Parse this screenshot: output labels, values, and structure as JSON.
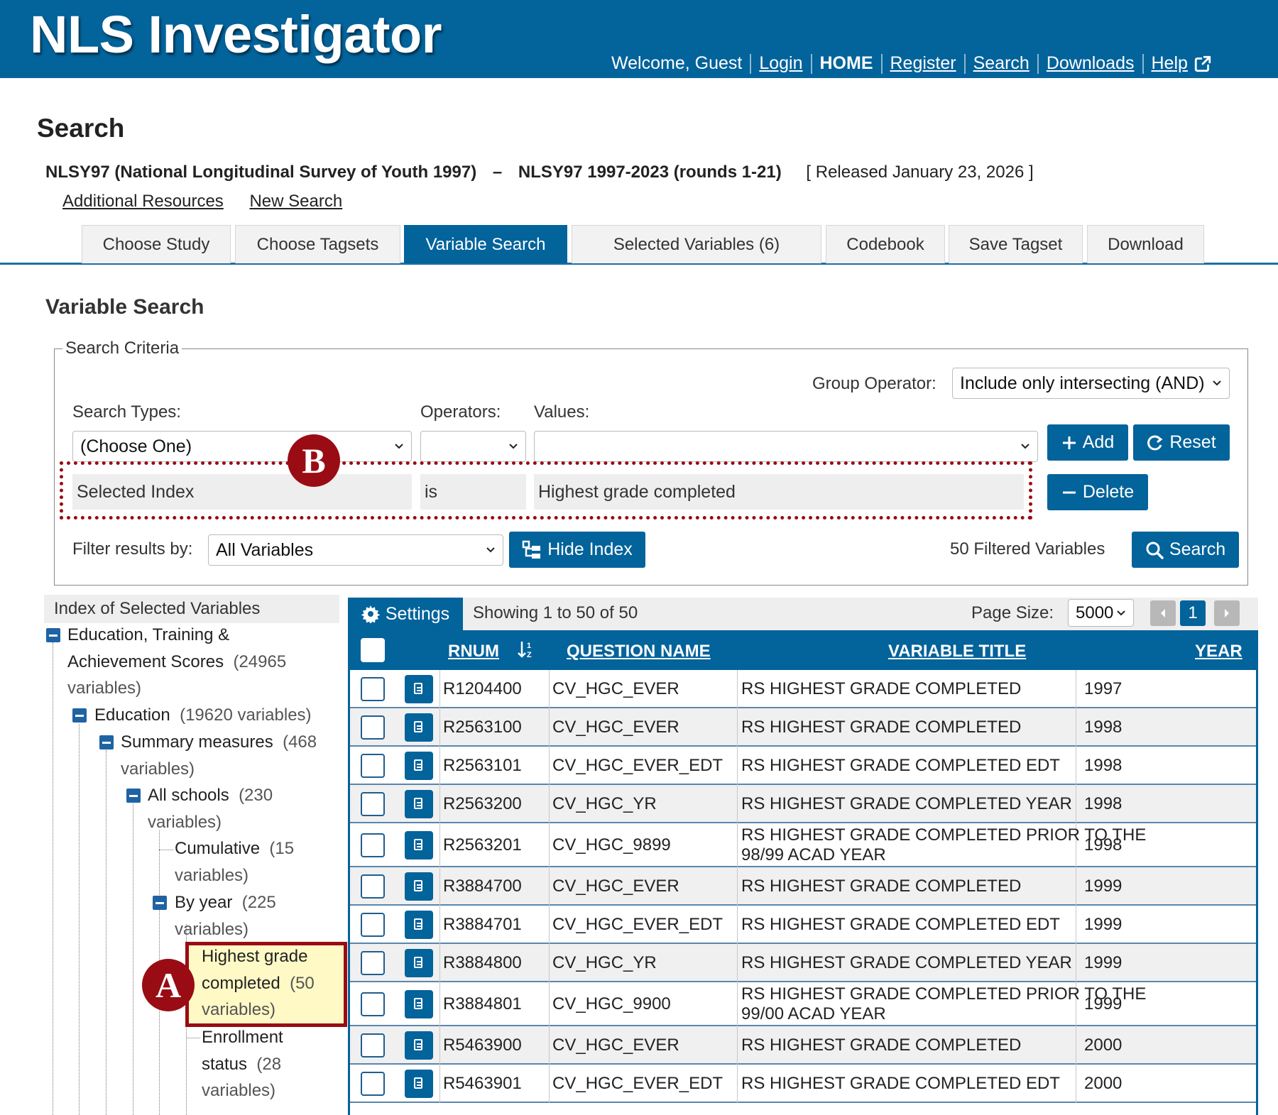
{
  "header": {
    "app_title": "NLS Investigator",
    "welcome": "Welcome, Guest",
    "links": [
      "Login",
      "HOME",
      "Register",
      "Search",
      "Downloads",
      "Help"
    ]
  },
  "page": {
    "title": "Search",
    "study": "NLSY97 (National Longitudinal Survey of Youth 1997)",
    "dash": "–",
    "rounds": "NLSY97 1997-2023 (rounds 1-21)",
    "released": "[ Released January 23, 2026 ]",
    "resource_links": [
      "Additional Resources",
      "New Search"
    ]
  },
  "tabs": [
    "Choose Study",
    "Choose Tagsets",
    "Variable Search",
    "Selected Variables (6)",
    "Codebook",
    "Save Tagset",
    "Download"
  ],
  "variable_search": {
    "title": "Variable Search",
    "criteria_legend": "Search Criteria",
    "group_operator_label": "Group Operator:",
    "group_operator_value": "Include only intersecting (AND)",
    "search_types_label": "Search Types:",
    "operators_label": "Operators:",
    "values_label": "Values:",
    "search_type_value": "(Choose One)",
    "add_label": "Add",
    "reset_label": "Reset",
    "delete_label": "Delete",
    "criterion": {
      "type": "Selected Index",
      "operator": "is",
      "value": "Highest grade completed"
    },
    "filter_label": "Filter results by:",
    "filter_value": "All Variables",
    "hide_index_label": "Hide Index",
    "filtered_count": "50 Filtered Variables",
    "search_label": "Search"
  },
  "markers": {
    "a": "A",
    "b": "B"
  },
  "tree": {
    "header": "Index of Selected Variables",
    "nodes": [
      {
        "lines": [
          "Education, Training &",
          "Achievement Scores",
          "variables)"
        ],
        "count": "(24965"
      },
      {
        "lines": [
          "Education"
        ],
        "count": "(19620 variables)"
      },
      {
        "lines": [
          "Summary measures",
          "variables)"
        ],
        "count": "(468"
      },
      {
        "lines": [
          "All schools",
          "variables)"
        ],
        "count": "(230"
      },
      {
        "lines": [
          "Cumulative",
          "variables)"
        ],
        "count": "(15"
      },
      {
        "lines": [
          "By year",
          "variables)"
        ],
        "count": "(225"
      },
      {
        "lines": [
          "Highest grade",
          "completed",
          "variables)"
        ],
        "count": "(50"
      },
      {
        "lines": [
          "Enrollment",
          "status",
          "variables)"
        ],
        "count": "(28"
      }
    ]
  },
  "grid": {
    "settings_label": "Settings",
    "showing": "Showing 1 to 50 of 50",
    "page_size_label": "Page Size:",
    "page_size_value": "5000",
    "current_page": "1",
    "columns": [
      "RNUM",
      "QUESTION NAME",
      "VARIABLE TITLE",
      "YEAR"
    ],
    "rows": [
      {
        "rnum": "R1204400",
        "question": "CV_HGC_EVER",
        "title": [
          "RS HIGHEST GRADE COMPLETED"
        ],
        "year": "1997"
      },
      {
        "rnum": "R2563100",
        "question": "CV_HGC_EVER",
        "title": [
          "RS HIGHEST GRADE COMPLETED"
        ],
        "year": "1998"
      },
      {
        "rnum": "R2563101",
        "question": "CV_HGC_EVER_EDT",
        "title": [
          "RS HIGHEST GRADE COMPLETED EDT"
        ],
        "year": "1998"
      },
      {
        "rnum": "R2563200",
        "question": "CV_HGC_YR",
        "title": [
          "RS HIGHEST GRADE COMPLETED YEAR"
        ],
        "year": "1998"
      },
      {
        "rnum": "R2563201",
        "question": "CV_HGC_9899",
        "title": [
          "RS HIGHEST GRADE COMPLETED PRIOR TO THE",
          "98/99 ACAD YEAR"
        ],
        "year": "1998"
      },
      {
        "rnum": "R3884700",
        "question": "CV_HGC_EVER",
        "title": [
          "RS HIGHEST GRADE COMPLETED"
        ],
        "year": "1999"
      },
      {
        "rnum": "R3884701",
        "question": "CV_HGC_EVER_EDT",
        "title": [
          "RS HIGHEST GRADE COMPLETED EDT"
        ],
        "year": "1999"
      },
      {
        "rnum": "R3884800",
        "question": "CV_HGC_YR",
        "title": [
          "RS HIGHEST GRADE COMPLETED YEAR"
        ],
        "year": "1999"
      },
      {
        "rnum": "R3884801",
        "question": "CV_HGC_9900",
        "title": [
          "RS HIGHEST GRADE COMPLETED PRIOR TO THE",
          "99/00 ACAD YEAR"
        ],
        "year": "1999"
      },
      {
        "rnum": "R5463900",
        "question": "CV_HGC_EVER",
        "title": [
          "RS HIGHEST GRADE COMPLETED"
        ],
        "year": "2000"
      },
      {
        "rnum": "R5463901",
        "question": "CV_HGC_EVER_EDT",
        "title": [
          "RS HIGHEST GRADE COMPLETED EDT"
        ],
        "year": "2000"
      }
    ]
  },
  "colors": {
    "brand": "#03639b",
    "highlight": "#fff9c5",
    "marker": "#990c14"
  }
}
